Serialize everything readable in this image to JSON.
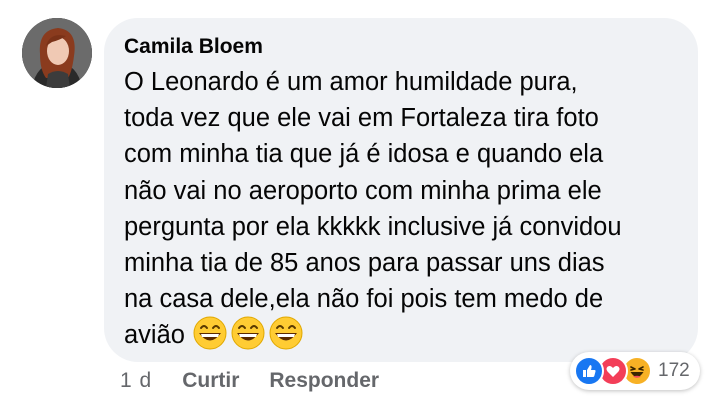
{
  "comment": {
    "author": "Camila Bloem",
    "text_lines": [
      "O Leonardo é um amor humildade pura,",
      "toda vez que ele vai em Fortaleza tira foto",
      "com minha tia que já é idosa e quando ela",
      "não vai no aeroporto com minha prima ele",
      "pergunta por ela kkkkk inclusive já convidou",
      "minha tia de 85 anos para passar uns dias",
      "na casa dele,ela não foi pois tem medo de",
      "avião"
    ],
    "emojis": [
      "grinning-face-icon",
      "grinning-face-icon",
      "grinning-face-icon"
    ]
  },
  "actions": {
    "time": "1 d",
    "like_label": "Curtir",
    "reply_label": "Responder"
  },
  "reactions": {
    "icons": [
      "like-icon",
      "love-icon",
      "haha-icon"
    ],
    "count": "172",
    "colors": {
      "like": "#1877f2",
      "love": "#f33e58",
      "haha": "#f7b125"
    }
  },
  "colors": {
    "bubble": "#f0f2f5",
    "text": "#050505",
    "secondary": "#65676b"
  }
}
